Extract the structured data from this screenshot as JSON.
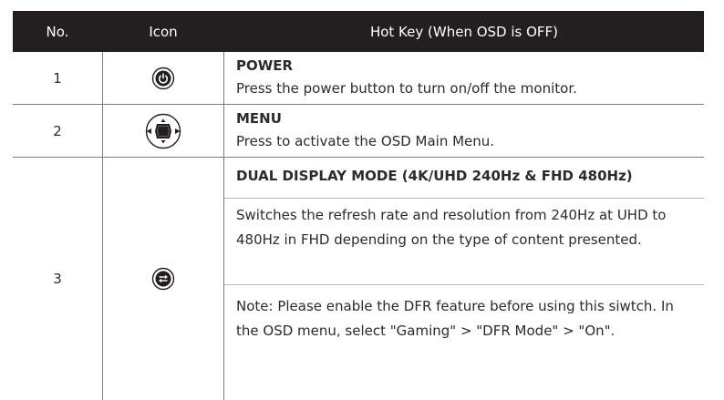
{
  "header": {
    "no": "No.",
    "icon": "Icon",
    "hotkey": "Hot Key (When OSD is OFF)"
  },
  "rows": [
    {
      "no": "1",
      "icon": "power-button-icon",
      "title": "POWER",
      "desc": "Press the power button to turn on/off the monitor."
    },
    {
      "no": "2",
      "icon": "menu-joystick-icon",
      "title": "MENU",
      "desc": "Press to activate the OSD Main Menu."
    },
    {
      "no": "3",
      "icon": "dual-mode-switch-icon",
      "title": "DUAL DISPLAY MODE  (4K/UHD 240Hz & FHD 480Hz)",
      "desc": "Switches the refresh rate and resolution from 240Hz at UHD to 480Hz in FHD depending on the type of content presented.",
      "note": "Note: Please enable the DFR feature before using this siwtch. In the OSD menu, select \"Gaming\" > \"DFR Mode\" > \"On\"."
    }
  ]
}
